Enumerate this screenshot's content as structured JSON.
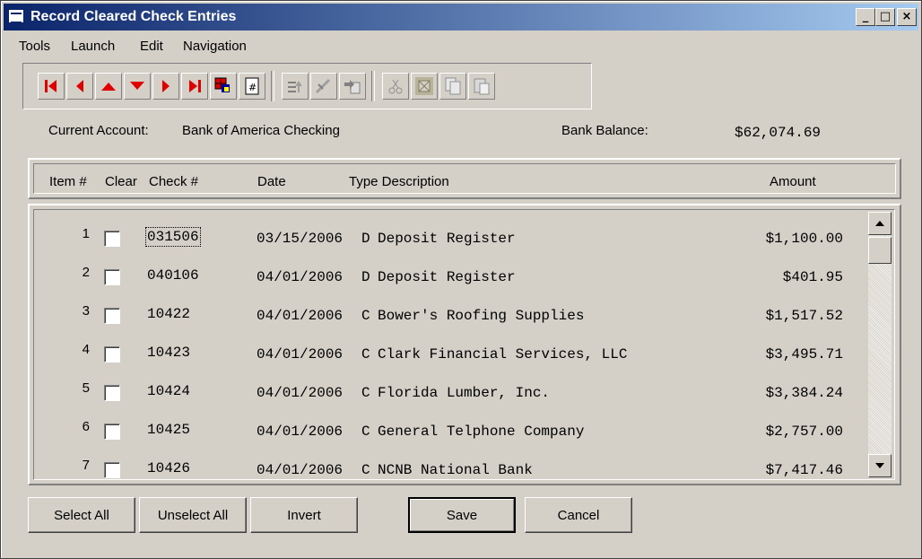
{
  "window": {
    "title": "Record Cleared Check Entries",
    "minimize_glyph": "_",
    "maximize_glyph": "□",
    "close_glyph": "×"
  },
  "menu": {
    "items": [
      "Tools",
      "Launch",
      "Edit",
      "Navigation"
    ]
  },
  "toolbar": {
    "buttons": [
      {
        "name": "first-record",
        "icon": "first-record-icon"
      },
      {
        "name": "previous-record",
        "icon": "previous-record-icon"
      },
      {
        "name": "up",
        "icon": "up-arrow-icon"
      },
      {
        "name": "down",
        "icon": "down-arrow-icon"
      },
      {
        "name": "next-record",
        "icon": "next-record-icon"
      },
      {
        "name": "last-record",
        "icon": "last-record-icon"
      },
      {
        "name": "find",
        "icon": "search-grid-icon"
      },
      {
        "name": "calculator",
        "icon": "calculator-icon"
      },
      {
        "name": "sort",
        "icon": "sort-icon",
        "enabled": false
      },
      {
        "name": "edit",
        "icon": "pen-icon",
        "enabled": false
      },
      {
        "name": "insert",
        "icon": "insert-icon",
        "enabled": false
      },
      {
        "name": "cut",
        "icon": "scissors-icon",
        "enabled": false
      },
      {
        "name": "delete",
        "icon": "delete-icon",
        "enabled": false
      },
      {
        "name": "copy",
        "icon": "copy-icon",
        "enabled": false
      },
      {
        "name": "paste",
        "icon": "paste-icon",
        "enabled": false
      }
    ]
  },
  "account": {
    "label": "Current Account:",
    "value": "Bank of America Checking",
    "balance_label": "Bank Balance:",
    "balance_value": "$62,074.69"
  },
  "columns": {
    "item": "Item #",
    "clear": "Clear",
    "check": "Check #",
    "date": "Date",
    "type_desc": "Type Description",
    "amount": "Amount"
  },
  "rows": [
    {
      "item": "1",
      "cleared": false,
      "check": "031506",
      "date": "03/15/2006",
      "type": "D",
      "description": "Deposit Register",
      "amount": "$1,100.00"
    },
    {
      "item": "2",
      "cleared": false,
      "check": "040106",
      "date": "04/01/2006",
      "type": "D",
      "description": "Deposit Register",
      "amount": "$401.95"
    },
    {
      "item": "3",
      "cleared": false,
      "check": "10422",
      "date": "04/01/2006",
      "type": "C",
      "description": "Bower's Roofing Supplies",
      "amount": "$1,517.52"
    },
    {
      "item": "4",
      "cleared": false,
      "check": "10423",
      "date": "04/01/2006",
      "type": "C",
      "description": "Clark Financial Services, LLC",
      "amount": "$3,495.71"
    },
    {
      "item": "5",
      "cleared": false,
      "check": "10424",
      "date": "04/01/2006",
      "type": "C",
      "description": "Florida Lumber, Inc.",
      "amount": "$3,384.24"
    },
    {
      "item": "6",
      "cleared": false,
      "check": "10425",
      "date": "04/01/2006",
      "type": "C",
      "description": "General Telphone Company",
      "amount": "$2,757.00"
    },
    {
      "item": "7",
      "cleared": false,
      "check": "10426",
      "date": "04/01/2006",
      "type": "C",
      "description": "NCNB National Bank",
      "amount": "$7,417.46"
    }
  ],
  "buttons": {
    "select_all": "Select All",
    "unselect_all": "Unselect All",
    "invert": "Invert",
    "save": "Save",
    "cancel": "Cancel"
  },
  "colors": {
    "title_start": "#0a246a",
    "title_end": "#a6caf0",
    "face": "#d4d0c8",
    "toolbar_red": "#e00000"
  }
}
